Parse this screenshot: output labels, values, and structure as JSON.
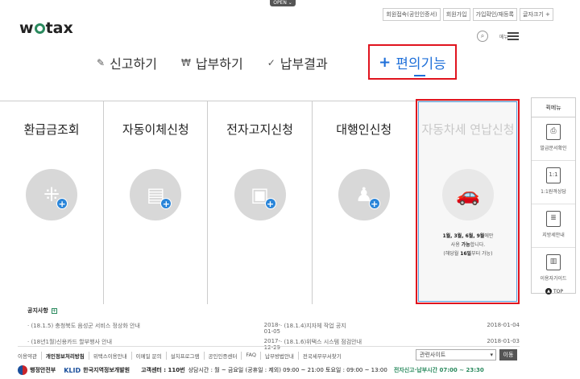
{
  "open_tab": "OPEN ⌄",
  "logo": {
    "prefix": "w",
    "suffix": "tax"
  },
  "top_links": [
    "회원접속(공인인증서)",
    "회원가입",
    "가입확인/재등록"
  ],
  "font_size_label": "글자크기 +",
  "menu_label": "메뉴",
  "nav": [
    {
      "icon": "✎",
      "label": "신고하기"
    },
    {
      "icon": "₩",
      "label": "납부하기"
    },
    {
      "icon": "✓",
      "label": "납부결과"
    }
  ],
  "nav_active": {
    "icon": "+",
    "label": "편의기능"
  },
  "cards": [
    {
      "title": "환급금조회",
      "glyph": "⁜"
    },
    {
      "title": "자동이체신청",
      "glyph": "▤"
    },
    {
      "title": "전자고지신청",
      "glyph": "▣"
    },
    {
      "title": "대행인신청",
      "glyph": "♟"
    },
    {
      "title": "자동차세 연납신청",
      "glyph": "🚗"
    }
  ],
  "disabled_card_notice": {
    "line1_a": "1월, 3월, 6월, 9월",
    "line1_b": "에만",
    "line2_a": "사용 ",
    "line2_b": "가능",
    "line2_c": "합니다.",
    "line3_a": "(해당월 ",
    "line3_b": "16일",
    "line3_c": "부터 가능)"
  },
  "notice": {
    "title": "공지사항",
    "more": "+",
    "rows": [
      {
        "left": "· (18.1.5) 충청북도 음성군 서비스 정상화 안내",
        "left_date": "2018-01-05",
        "right": "· (18.1.4)지자체 작업 공지",
        "right_date": "2018-01-04"
      },
      {
        "left": "· (18년1월)신용카드 할부행사 안내",
        "left_date": "2017-12-29",
        "right": "· (18.1.6)위택스 시스템 점검안내",
        "right_date": "2018-01-03"
      }
    ]
  },
  "footer_links": [
    "이용약관",
    "개인정보처리방침",
    "위택스이용안내",
    "이메일 문의",
    "설치프로그램",
    "공인인증센터",
    "FAQ",
    "납부방법안내",
    "전국세무부서찾기"
  ],
  "related_select": "관련사이트",
  "go_button": "이동",
  "footer": {
    "org1": "행정안전부",
    "org2_brand": "KLID",
    "org2_name": " 한국지역정보개발원",
    "contact_label": "고객센터 : 110번",
    "hours": "상담시간 : 월 ~ 금요일 (공휴일 : 제외) 09:00 ~ 21:00 토요일 : 09:00 ~ 13:00",
    "tax_hours": "전자신고·납부시간 07:00 ~ 23:30"
  },
  "quick_menu": {
    "title": "퀵메뉴",
    "items": [
      {
        "icon": "printer-icon",
        "glyph": "⎙",
        "label": "발급문서확인"
      },
      {
        "icon": "chat-icon",
        "glyph": "1:1",
        "label": "1:1원격상담"
      },
      {
        "icon": "document-icon",
        "glyph": "≣",
        "label": "지방세안내"
      },
      {
        "icon": "book-icon",
        "glyph": "▥",
        "label": "이용자가이드"
      }
    ]
  },
  "top_button": "TOP",
  "colors": {
    "highlight": "#e0141e",
    "accent_blue": "#1e6fd9",
    "brand_green": "#2a8a5e"
  }
}
